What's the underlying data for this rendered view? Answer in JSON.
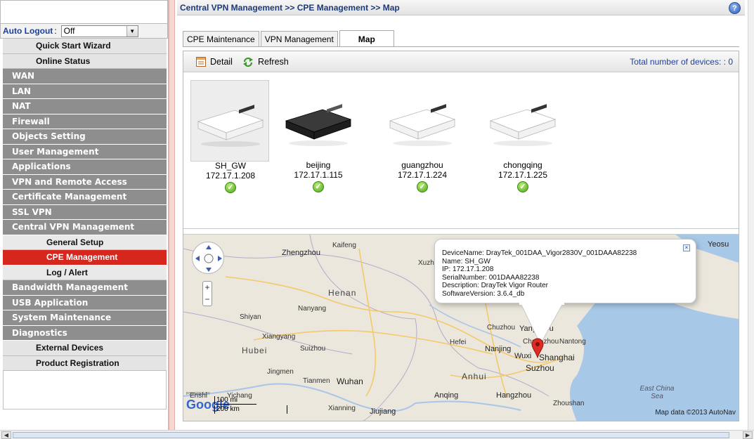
{
  "sidebar": {
    "auto_logout_label": "Auto Logout",
    "auto_logout_value": "Off",
    "items": [
      {
        "label": "Quick Start Wizard",
        "style": "plain"
      },
      {
        "label": "Online Status",
        "style": "plain"
      },
      {
        "label": "WAN",
        "style": "gray"
      },
      {
        "label": "LAN",
        "style": "gray"
      },
      {
        "label": "NAT",
        "style": "gray"
      },
      {
        "label": "Firewall",
        "style": "gray"
      },
      {
        "label": "Objects Setting",
        "style": "gray"
      },
      {
        "label": "User Management",
        "style": "gray"
      },
      {
        "label": "Applications",
        "style": "gray"
      },
      {
        "label": "VPN and Remote Access",
        "style": "gray"
      },
      {
        "label": "Certificate Management",
        "style": "gray"
      },
      {
        "label": "SSL VPN",
        "style": "gray"
      },
      {
        "label": "Central VPN Management",
        "style": "gray"
      },
      {
        "label": "General Setup",
        "style": "sub"
      },
      {
        "label": "CPE Management",
        "style": "active"
      },
      {
        "label": "Log / Alert",
        "style": "sub"
      },
      {
        "label": "Bandwidth Management",
        "style": "gray"
      },
      {
        "label": "USB Application",
        "style": "gray"
      },
      {
        "label": "System Maintenance",
        "style": "gray"
      },
      {
        "label": "Diagnostics",
        "style": "gray"
      },
      {
        "label": "External Devices",
        "style": "plain"
      },
      {
        "label": "Product Registration",
        "style": "plain"
      }
    ]
  },
  "header": {
    "breadcrumb": "Central VPN Management >> CPE Management >> Map",
    "help_icon": "help-icon"
  },
  "tabs": [
    "CPE Maintenance",
    "VPN Management",
    "Map"
  ],
  "toolbar": {
    "detail_label": "Detail",
    "refresh_label": "Refresh",
    "total_label": "Total number of devices: : 0"
  },
  "devices": [
    {
      "name": "SH_GW",
      "ip": "172.17.1.208",
      "color": "white",
      "selected": true
    },
    {
      "name": "beijing",
      "ip": "172.17.1.115",
      "color": "black",
      "selected": false
    },
    {
      "name": "guangzhou",
      "ip": "172.17.1.224",
      "color": "white",
      "selected": false
    },
    {
      "name": "chongqing",
      "ip": "172.17.1.225",
      "color": "white",
      "selected": false
    }
  ],
  "map": {
    "balloon": [
      "DeviceName: DrayTek_001DAA_Vigor2830V_001DAAA82238",
      "Name: SH_GW",
      "IP: 172.17.1.208",
      "SerialNumber: 001DAAA82238",
      "Description: DrayTek Vigor Router",
      "SoftwareVersion: 3.6.4_db"
    ],
    "labels": {
      "zhengzhou": "Zhengzhou",
      "kaifeng": "Kaifeng",
      "henan": "Henan",
      "nanyang": "Nanyang",
      "shiyan": "Shiyan",
      "xiangyang": "Xiangyang",
      "suizhou": "Suizhou",
      "hubei": "Hubei",
      "jingmen": "Jingmen",
      "tianmen": "Tianmen",
      "wuhan": "Wuhan",
      "enshi": "Enshi",
      "yichang": "Yichang",
      "xianning": "Xianning",
      "jiujiang": "Jiujiang",
      "anhui": "Anhui",
      "anqing": "Anqing",
      "hefei": "Hefei",
      "xuzhou": "Xuzhou",
      "chuzhou": "Chuzhou",
      "yangzhou": "Yangzhou",
      "nanjing": "Nanjing",
      "changzhou": "Changzhou",
      "nantong": "Nantong",
      "wuxi": "Wuxi",
      "suzhou": "Suzhou",
      "shanghai": "Shanghai",
      "hangzhou": "Hangzhou",
      "zhoushan": "Zhoushan",
      "yeosu": "Yeosu",
      "east_china_sea": "East China Sea"
    },
    "scale_mi": "100 mi",
    "scale_km": "200 km",
    "attribution": "Map data ©2013 AutoNav",
    "google_logo": "Google",
    "powered_by": "POWERED BY"
  }
}
